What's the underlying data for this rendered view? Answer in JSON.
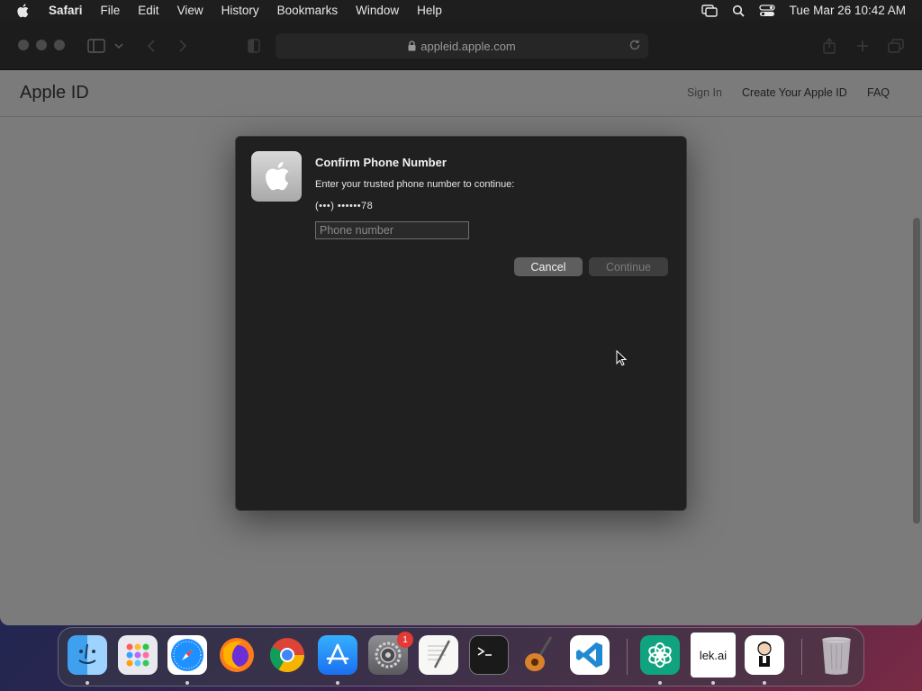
{
  "menubar": {
    "app_name": "Safari",
    "items": [
      "File",
      "Edit",
      "View",
      "History",
      "Bookmarks",
      "Window",
      "Help"
    ],
    "clock": "Tue Mar 26  10:42 AM"
  },
  "browser": {
    "address": "appleid.apple.com"
  },
  "page": {
    "title": "Apple ID",
    "nav": {
      "sign_in": "Sign In",
      "create": "Create Your Apple ID",
      "faq": "FAQ"
    }
  },
  "dialog": {
    "title": "Confirm Phone Number",
    "message": "Enter your trusted phone number to continue:",
    "masked_number": "(•••) ••••••78",
    "input_placeholder": "Phone number",
    "cancel_label": "Cancel",
    "continue_label": "Continue"
  },
  "dock": {
    "apps": [
      {
        "name": "Finder"
      },
      {
        "name": "Launchpad"
      },
      {
        "name": "Safari"
      },
      {
        "name": "Firefox"
      },
      {
        "name": "Chrome"
      },
      {
        "name": "App Store"
      },
      {
        "name": "System Settings"
      },
      {
        "name": "TextEdit"
      },
      {
        "name": "Terminal"
      },
      {
        "name": "GarageBand"
      },
      {
        "name": "Visual Studio Code"
      },
      {
        "name": "ChatGPT"
      },
      {
        "name": "lek.ai"
      },
      {
        "name": "Character App"
      },
      {
        "name": "Trash"
      }
    ],
    "settings_badge": "1",
    "lekai_label": "lek.ai"
  },
  "colors": {
    "dialog_bg": "#202020",
    "page_bg": "#7b7b7b",
    "badge": "#e53935"
  }
}
